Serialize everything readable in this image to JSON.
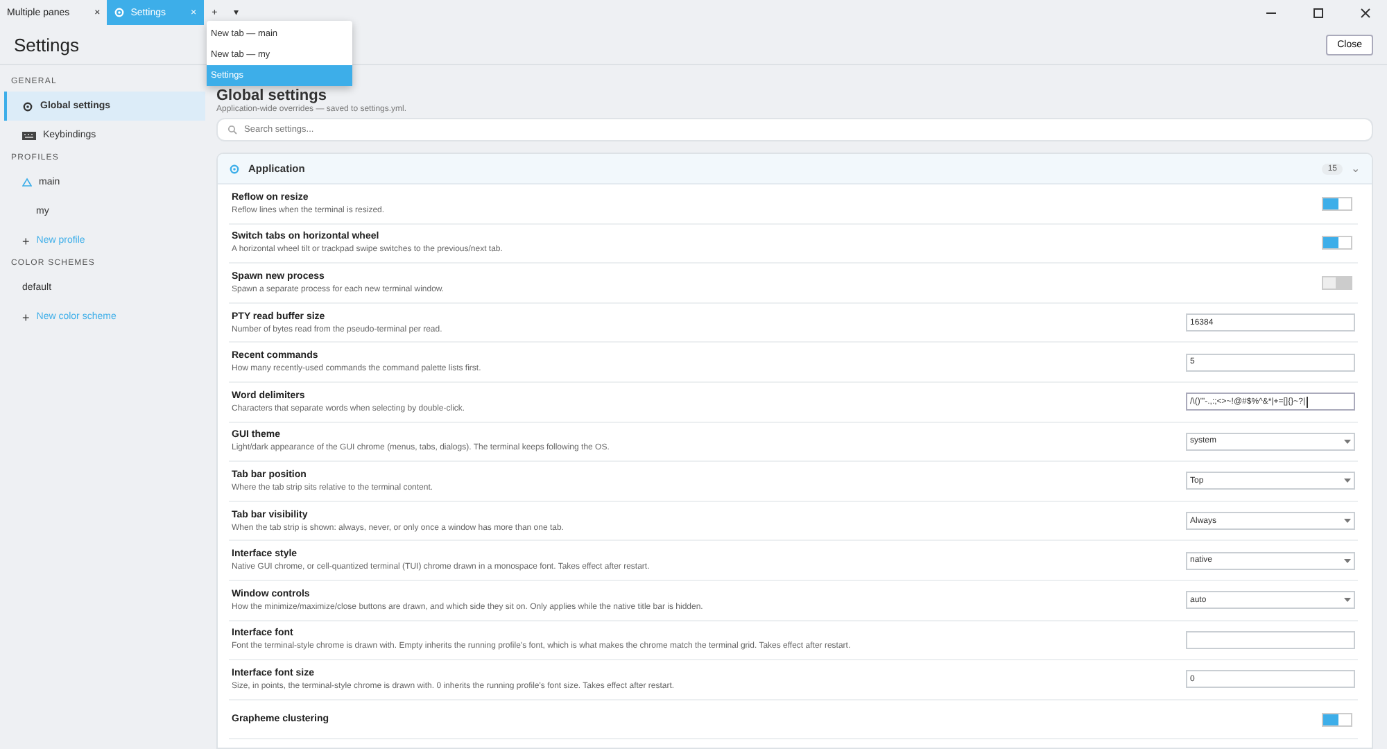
{
  "tabs": [
    {
      "label": "Multiple panes",
      "selected": false,
      "close": "×"
    },
    {
      "label": "Settings",
      "selected": true,
      "close": "×"
    }
  ],
  "tab_actions": [
    "+",
    "▾"
  ],
  "header": {
    "title": "Settings",
    "close_button": "Close"
  },
  "sidebar": [
    {
      "heading": "GENERAL",
      "items": [
        {
          "label": "Global settings",
          "kind": "settings",
          "selected": true
        },
        {
          "label": "Keybindings",
          "kind": "keyboard",
          "selected": false
        }
      ]
    },
    {
      "heading": "PROFILES",
      "items": [
        {
          "label": "main",
          "kind": "profile",
          "selected": false
        },
        {
          "label": "my",
          "kind": "plain",
          "selected": false
        },
        {
          "label": "New profile",
          "kind": "add",
          "plus": "+",
          "selected": false
        }
      ]
    },
    {
      "heading": "COLOR SCHEMES",
      "items": [
        {
          "label": "default",
          "kind": "plain",
          "selected": false
        },
        {
          "label": "New color scheme",
          "kind": "add",
          "plus": "+",
          "selected": false
        }
      ]
    }
  ],
  "page": {
    "title": "Global settings",
    "subtitle": "Application-wide overrides — saved to settings.yml.",
    "search": {
      "placeholder": "Search settings..."
    }
  },
  "section": {
    "title": "Application",
    "count": "15",
    "chevron": "⌄",
    "expanded": true,
    "rows": [
      {
        "title": "Reflow on resize",
        "description": "Reflow lines when the terminal is resized.",
        "control": {
          "kind": "toggle",
          "on": true
        }
      },
      {
        "title": "Switch tabs on horizontal wheel",
        "description": "A horizontal wheel tilt or trackpad swipe switches to the previous/next tab.",
        "control": {
          "kind": "toggle",
          "on": true
        }
      },
      {
        "title": "Spawn new process",
        "description": "Spawn a separate process for each new terminal window.",
        "control": {
          "kind": "toggle",
          "on": false
        }
      },
      {
        "title": "PTY read buffer size",
        "description": "Number of bytes read from the pseudo-terminal per read.",
        "control": {
          "kind": "input",
          "value": "16384"
        }
      },
      {
        "title": "Recent commands",
        "description": "How many recently-used commands the command palette lists first.",
        "control": {
          "kind": "input",
          "value": "5"
        }
      },
      {
        "title": "Word delimiters",
        "description": "Characters that separate words when selecting by double-click.",
        "control": {
          "kind": "input",
          "value": "/\\()\"'-.,:;<>~!@#$%^&*|+=[]{}~?|",
          "focused": true
        }
      },
      {
        "title": "GUI theme",
        "description": "Light/dark appearance of the GUI chrome (menus, tabs, dialogs). The terminal keeps following the OS.",
        "control": {
          "kind": "select",
          "value": "system"
        }
      },
      {
        "title": "Tab bar position",
        "description": "Where the tab strip sits relative to the terminal content.",
        "control": {
          "kind": "select",
          "value": "Top"
        }
      },
      {
        "title": "Tab bar visibility",
        "description": "When the tab strip is shown: always, never, or only once a window has more than one tab.",
        "control": {
          "kind": "select",
          "value": "Always"
        }
      },
      {
        "title": "Interface style",
        "description": "Native GUI chrome, or cell-quantized terminal (TUI) chrome drawn in a monospace font. Takes effect after restart.",
        "control": {
          "kind": "select",
          "value": "native"
        }
      },
      {
        "title": "Window controls",
        "description": "How the minimize/maximize/close buttons are drawn, and which side they sit on. Only applies while the native title bar is hidden.",
        "control": {
          "kind": "select",
          "value": "auto"
        }
      },
      {
        "title": "Interface font",
        "description": "Font the terminal-style chrome is drawn with. Empty inherits the running profile's font, which is what makes the chrome match the terminal grid. Takes effect after restart.",
        "control": {
          "kind": "input"
        }
      },
      {
        "title": "Interface font size",
        "description": "Size, in points, the terminal-style chrome is drawn with. 0 inherits the running profile's font size. Takes effect after restart.",
        "control": {
          "kind": "input",
          "value": "0"
        }
      },
      {
        "title": "Grapheme clustering",
        "control": {
          "kind": "toggle",
          "on": true
        }
      }
    ]
  },
  "menu": [
    {
      "label": "New tab — main",
      "selected": false
    },
    {
      "label": "New tab — my",
      "selected": false
    },
    {
      "label": "Settings",
      "selected": true
    }
  ]
}
